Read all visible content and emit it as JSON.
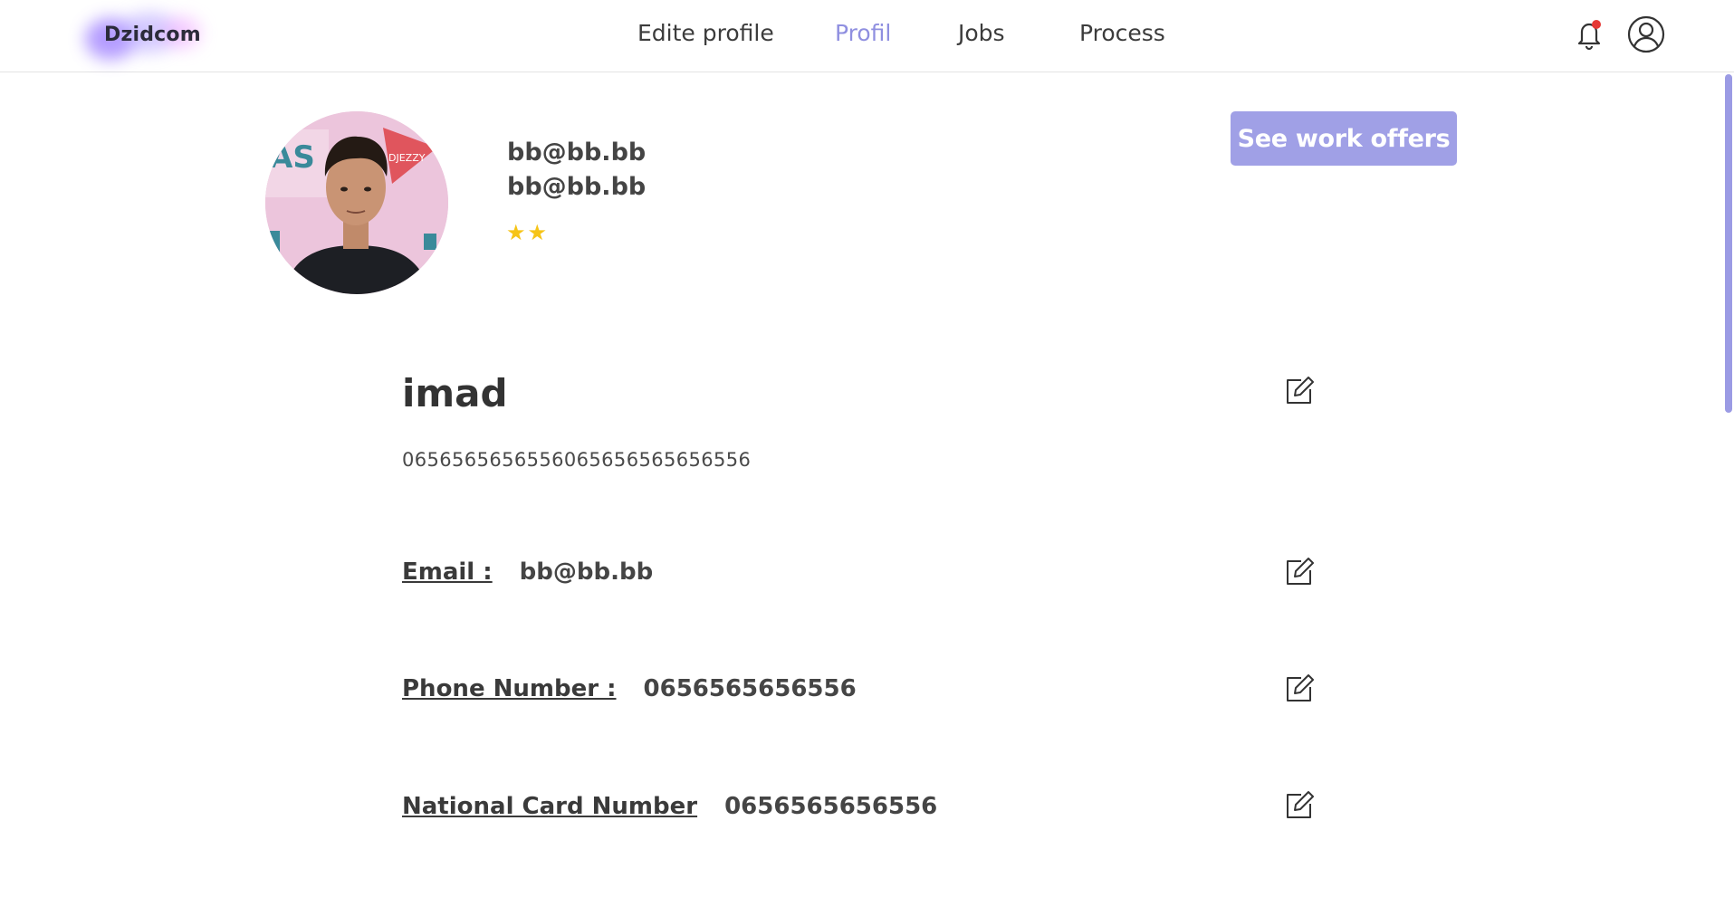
{
  "brand": {
    "name": "Dzidcom"
  },
  "nav": {
    "items": [
      {
        "label": "Edite profile",
        "active": false
      },
      {
        "label": "Profil",
        "active": true
      },
      {
        "label": "Jobs",
        "active": false
      },
      {
        "label": "Process",
        "active": false
      }
    ]
  },
  "header_icons": {
    "notification": "bell-icon",
    "account": "user-circle-icon",
    "notification_dot_color": "#e53935"
  },
  "profile": {
    "id_line_1": "bb@bb.bb",
    "id_line_2": "bb@bb.bb",
    "stars": "★★",
    "rating_stars": 2,
    "offers_button": "See work offers",
    "name": "imad",
    "subline": "0656565656556065656565656556"
  },
  "fields": {
    "email": {
      "label": "Email :",
      "value": "bb@bb.bb"
    },
    "phone": {
      "label": "Phone Number :",
      "value": "0656565656556"
    },
    "national": {
      "label": "National Card Number",
      "value": "0656565656556"
    }
  },
  "colors": {
    "accent": "#a0a0e6",
    "active_nav": "#8f8fe0",
    "star": "#f6c417"
  }
}
